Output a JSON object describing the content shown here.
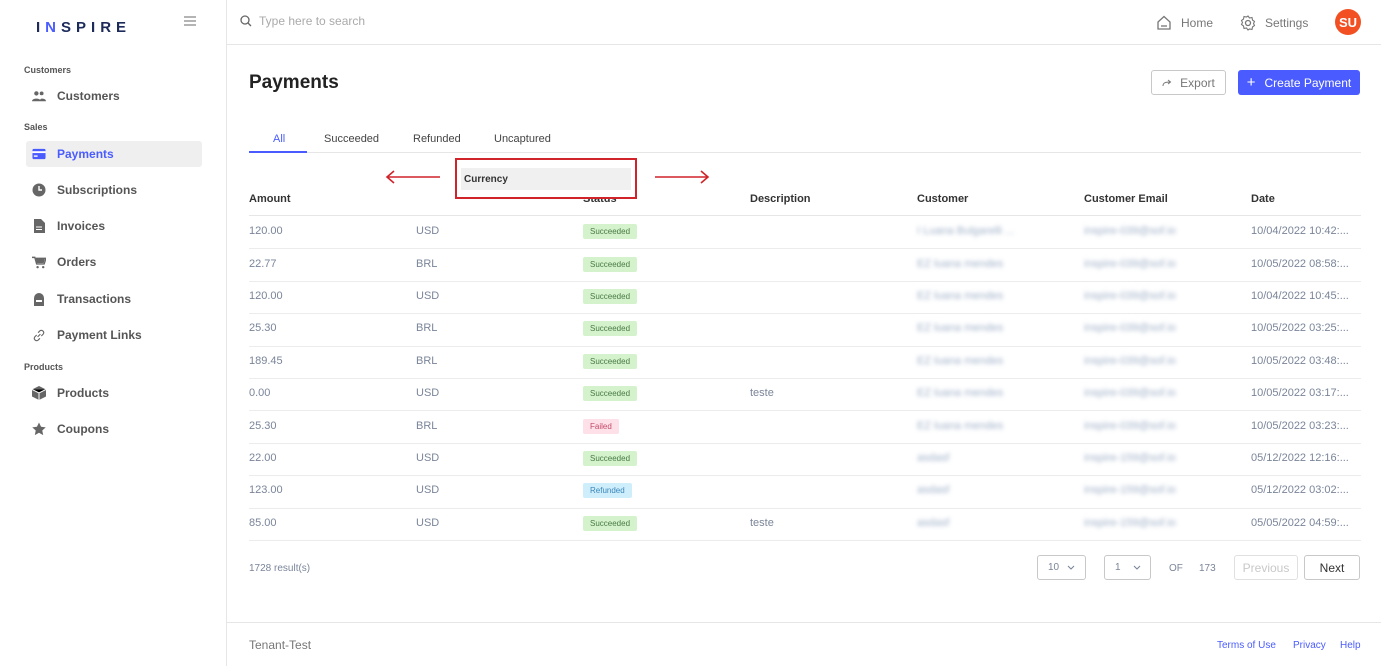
{
  "brand": {
    "logo_prefix": "I",
    "logo_n": "N",
    "logo_rest": "SPIRE"
  },
  "sidebar": {
    "sections": [
      "Customers",
      "Sales",
      "Products"
    ],
    "items": [
      {
        "label": "Customers",
        "icon": "users-icon"
      },
      {
        "label": "Payments",
        "icon": "credit-card-icon"
      },
      {
        "label": "Subscriptions",
        "icon": "clock-icon"
      },
      {
        "label": "Invoices",
        "icon": "document-icon"
      },
      {
        "label": "Orders",
        "icon": "cart-icon"
      },
      {
        "label": "Transactions",
        "icon": "bank-icon"
      },
      {
        "label": "Payment Links",
        "icon": "link-icon"
      },
      {
        "label": "Products",
        "icon": "box-icon"
      },
      {
        "label": "Coupons",
        "icon": "star-icon"
      }
    ]
  },
  "topbar": {
    "search_placeholder": "Type here to search",
    "home": "Home",
    "settings": "Settings",
    "avatar": "SU"
  },
  "page": {
    "title": "Payments",
    "export": "Export",
    "create": "Create Payment",
    "tabs": [
      "All",
      "Succeeded",
      "Refunded",
      "Uncaptured"
    ],
    "currency_highlight": "Currency"
  },
  "table": {
    "headers": [
      "Amount",
      "Status",
      "Description",
      "Customer",
      "Customer Email",
      "Date"
    ],
    "rows": [
      {
        "amount": "120.00",
        "currency": "USD",
        "status": "Succeeded",
        "description": "",
        "customer": "I Luana Bulgarelli ...",
        "email": "inspire-039@sof.io",
        "date": "10/04/2022 10:42:..."
      },
      {
        "amount": "22.77",
        "currency": "BRL",
        "status": "Succeeded",
        "description": "",
        "customer": "EZ luana mendes",
        "email": "inspire-039@sof.io",
        "date": "10/05/2022 08:58:..."
      },
      {
        "amount": "120.00",
        "currency": "USD",
        "status": "Succeeded",
        "description": "",
        "customer": "EZ luana mendes",
        "email": "inspire-039@sof.io",
        "date": "10/04/2022 10:45:..."
      },
      {
        "amount": "25.30",
        "currency": "BRL",
        "status": "Succeeded",
        "description": "",
        "customer": "EZ luana mendes",
        "email": "inspire-039@sof.io",
        "date": "10/05/2022 03:25:..."
      },
      {
        "amount": "189.45",
        "currency": "BRL",
        "status": "Succeeded",
        "description": "",
        "customer": "EZ luana mendes",
        "email": "inspire-039@sof.io",
        "date": "10/05/2022 03:48:..."
      },
      {
        "amount": "0.00",
        "currency": "USD",
        "status": "Succeeded",
        "description": "teste",
        "customer": "EZ luana mendes",
        "email": "inspire-039@sof.io",
        "date": "10/05/2022 03:17:..."
      },
      {
        "amount": "25.30",
        "currency": "BRL",
        "status": "Failed",
        "description": "",
        "customer": "EZ luana mendes",
        "email": "inspire-039@sof.io",
        "date": "10/05/2022 03:23:..."
      },
      {
        "amount": "22.00",
        "currency": "USD",
        "status": "Succeeded",
        "description": "",
        "customer": "asdasf",
        "email": "inspire-159@sof.io",
        "date": "05/12/2022 12:16:..."
      },
      {
        "amount": "123.00",
        "currency": "USD",
        "status": "Refunded",
        "description": "",
        "customer": "asdasf",
        "email": "inspire-159@sof.io",
        "date": "05/12/2022 03:02:..."
      },
      {
        "amount": "85.00",
        "currency": "USD",
        "status": "Succeeded",
        "description": "teste",
        "customer": "asdasf",
        "email": "inspire-159@sof.io",
        "date": "05/05/2022 04:59:..."
      }
    ]
  },
  "pagination": {
    "results": "1728 result(s)",
    "per_page": "10",
    "page": "1",
    "of_label": "OF",
    "total_pages": "173",
    "previous": "Previous",
    "next": "Next"
  },
  "footer": {
    "tenant": "Tenant-Test",
    "terms": "Terms of Use",
    "privacy": "Privacy",
    "help": "Help"
  },
  "colors": {
    "accent": "#4a5cff",
    "highlight_red": "#d0242a",
    "avatar": "#f25022"
  }
}
